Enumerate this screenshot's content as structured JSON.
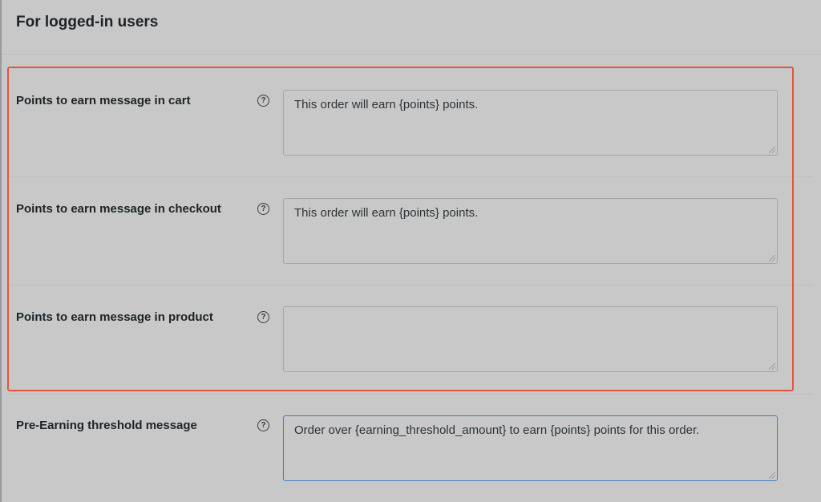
{
  "section": {
    "title": "For logged-in users"
  },
  "fields": [
    {
      "label": "Points to earn message in cart",
      "value": "This order will earn {points} points.",
      "placeholder": ""
    },
    {
      "label": "Points to earn message in checkout",
      "value": "This order will earn {points} points.",
      "placeholder": ""
    },
    {
      "label": "Points to earn message in product",
      "value": "",
      "placeholder": ""
    },
    {
      "label": "Pre-Earning threshold message",
      "value": "Order over {earning_threshold_amount} to earn {points} points for this order.",
      "placeholder": ""
    }
  ],
  "help_icon": {
    "name": "question-circle-icon",
    "glyph": "?"
  },
  "colors": {
    "highlight": "#e8543b",
    "focus": "#3f7ec2",
    "background": "#c8c8c8"
  }
}
